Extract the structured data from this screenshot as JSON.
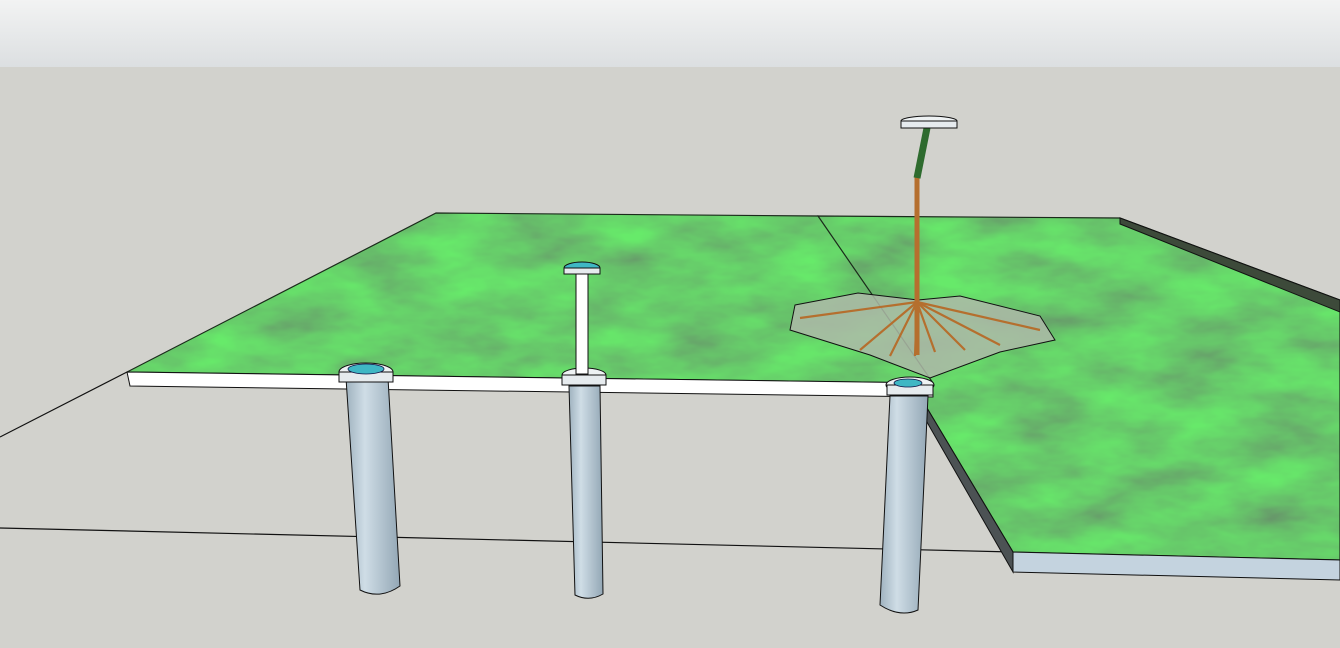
{
  "scene": {
    "sky_colors": [
      "#f2f3f3",
      "#dcdfe1"
    ],
    "ground_color": "#d2d2cd",
    "edge_color": "#111111"
  },
  "objects": {
    "slab_left": {
      "material": "grass-texture",
      "edge_color": "#ffffff"
    },
    "slab_right": {
      "material": "grass-texture",
      "edge_color": "#c4d3df"
    },
    "pillars": [
      {
        "name": "pillar-left",
        "color": "#b7c8d4",
        "cap_color": "#3fb7c4"
      },
      {
        "name": "pillar-middle",
        "color": "#b7c8d4",
        "cap_color": "#3fb7c4"
      },
      {
        "name": "pillar-right",
        "color": "#b7c8d4",
        "cap_color": "#3fb7c4"
      }
    ],
    "umbrella_extended": {
      "pole_color": "#ffffff",
      "cap_color": "#3fb7c4"
    },
    "umbrella_inverted": {
      "pole_color": "#b56f2e",
      "grip_color": "#2e6b2e",
      "canopy_color": "#aebaa8"
    }
  }
}
